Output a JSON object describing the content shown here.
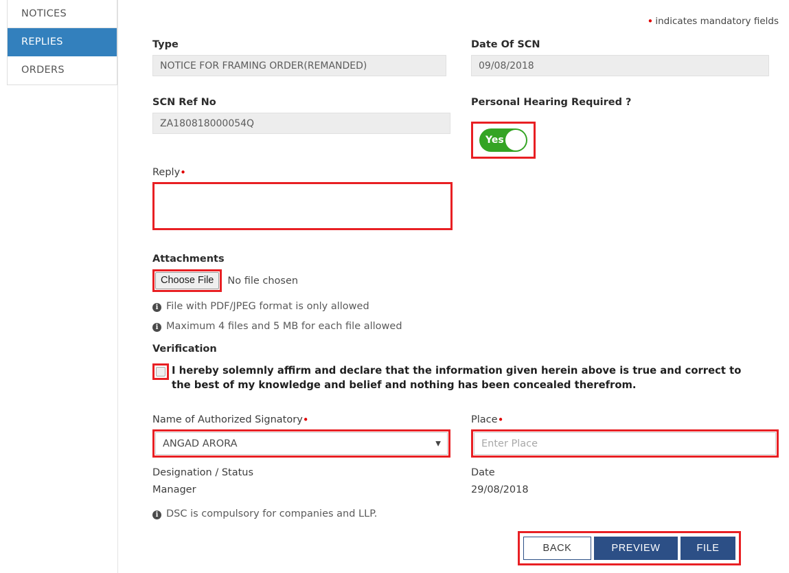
{
  "sidebar": {
    "items": [
      {
        "label": "NOTICES",
        "active": false
      },
      {
        "label": "REPLIES",
        "active": true
      },
      {
        "label": "ORDERS",
        "active": false
      }
    ]
  },
  "header": {
    "mandatory_note": "indicates mandatory fields",
    "mandatory_dot": "•"
  },
  "form": {
    "type": {
      "label": "Type",
      "value": "NOTICE FOR FRAMING ORDER(REMANDED)"
    },
    "date_of_scn": {
      "label": "Date Of SCN",
      "value": "09/08/2018"
    },
    "scn_ref_no": {
      "label": "SCN Ref No",
      "value": "ZA180818000054Q"
    },
    "personal_hearing": {
      "label": "Personal Hearing Required ?",
      "toggle_state": "Yes"
    },
    "reply": {
      "label": "Reply",
      "value": "",
      "placeholder": ""
    },
    "attachments": {
      "label": "Attachments",
      "choose_button": "Choose File",
      "file_status": "No file chosen",
      "notes": [
        "File with PDF/JPEG format is only allowed",
        "Maximum 4 files and 5 MB for each file allowed"
      ]
    },
    "verification": {
      "label": "Verification",
      "declaration": "I hereby solemnly affirm and declare that the information given herein above is true and correct to the best of my knowledge and belief and nothing has been concealed therefrom.",
      "checked": false
    },
    "signatory": {
      "label": "Name of Authorized Signatory",
      "selected": "ANGAD ARORA",
      "caret": "▼"
    },
    "designation": {
      "label": "Designation / Status",
      "value": "Manager"
    },
    "dsc_note": "DSC is compulsory for companies and LLP.",
    "place": {
      "label": "Place",
      "value": "",
      "placeholder": "Enter Place"
    },
    "date": {
      "label": "Date",
      "value": "29/08/2018"
    }
  },
  "actions": {
    "back": "BACK",
    "preview": "PREVIEW",
    "file": "FILE"
  },
  "icons": {
    "info": "i"
  },
  "colors": {
    "sidebar_active": "#3380bd",
    "primary_button": "#2c4f86",
    "toggle_on": "#34a424",
    "highlight": "#e81f23",
    "mandatory_dot": "#e00000"
  }
}
